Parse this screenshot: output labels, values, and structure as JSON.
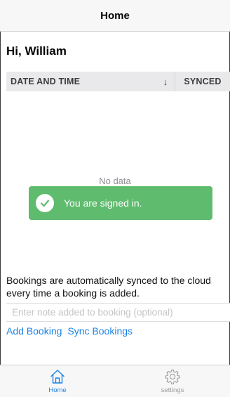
{
  "nav": {
    "title": "Home"
  },
  "greeting": "Hi, William",
  "table": {
    "columns": [
      "DATE AND TIME",
      "SYNCED"
    ],
    "sort_indicator": "↓",
    "empty_message": "No data"
  },
  "toast": {
    "icon": "checkmark-icon",
    "message": "You are signed in.",
    "color": "#5fbb6d"
  },
  "info_text": "Bookings are automatically synced to the cloud every time a booking is added.",
  "note_input": {
    "value": "",
    "placeholder": "Enter note added to booking (optional)"
  },
  "actions": {
    "add_booking": "Add Booking",
    "sync_bookings": "Sync Bookings"
  },
  "tabs": [
    {
      "label": "Home",
      "icon": "home-icon",
      "active": true
    },
    {
      "label": "settings",
      "icon": "gear-icon",
      "active": false
    }
  ],
  "colors": {
    "accent": "#1a82e6",
    "inactive": "#9a9a9e"
  }
}
